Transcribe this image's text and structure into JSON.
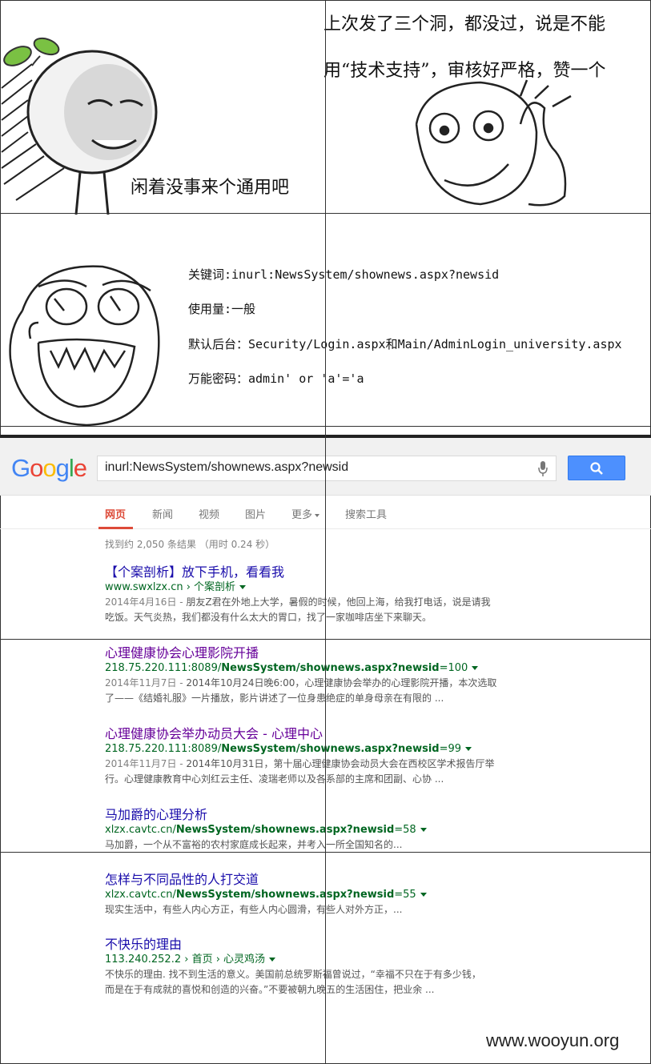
{
  "comic": {
    "panel1_caption": "闲着没事来个通用吧",
    "panel2_line1": "上次发了三个洞，都没过，说是不能",
    "panel2_line2": "用“技术支持”，审核好严格，赞一个",
    "info": [
      "关键词:inurl:NewsSystem/shownews.aspx?newsid",
      "使用量:一般",
      "默认后台：Security/Login.aspx和Main/AdminLogin_university.aspx",
      "万能密码：admin' or 'a'='a"
    ]
  },
  "google": {
    "logo": "Google",
    "search_value": "inurl:NewsSystem/shownews.aspx?newsid",
    "tabs": [
      "网页",
      "新闻",
      "视频",
      "图片",
      "更多",
      "搜索工具"
    ],
    "active_tab": "网页",
    "result_stats": "找到约 2,050 条结果 （用时 0.24 秒）",
    "results": [
      {
        "title": "【个案剖析】放下手机，看看我",
        "url_plain": "www.swxlzx.cn › 个案剖析",
        "snippet_date": "2014年4月16日 - ",
        "snippet_line1": "朋友Z君在外地上大学，暑假的时候，他回上海，给我打电话，说是请我",
        "snippet_line2": "吃饭。天气炎热，我们都没有什么太大的胃口，找了一家咖啡店坐下来聊天。"
      },
      {
        "title": "心理健康协会心理影院开播",
        "url_prefix": "218.75.220.111:8089/",
        "url_bold": "NewsSystem/shownews.aspx?newsid",
        "url_suffix": "=100",
        "snippet_date": "2014年11月7日 - ",
        "snippet_line1": "2014年10月24日晚6:00，心理健康协会举办的心理影院开播，本次选取",
        "snippet_line2": "了——《结婚礼服》一片播放，影片讲述了一位身患绝症的单身母亲在有限的 ..."
      },
      {
        "title": "心理健康协会举办动员大会 - 心理中心",
        "url_prefix": "218.75.220.111:8089/",
        "url_bold": "NewsSystem/shownews.aspx?newsid",
        "url_suffix": "=99",
        "snippet_date": "2014年11月7日 - ",
        "snippet_line1": "2014年10月31日，第十届心理健康协会动员大会在西校区学术报告厅举",
        "snippet_line2": "行。心理健康教育中心刘红云主任、凌瑞老师以及各系部的主席和团副、心协 ..."
      },
      {
        "title": "马加爵的心理分析",
        "url_prefix": "xlzx.cavtc.cn/",
        "url_bold": "NewsSystem/shownews.aspx?newsid",
        "url_suffix": "=58",
        "snippet_line1": "马加爵，一个从不富裕的农村家庭成长起来，并考入一所全国知名的..."
      },
      {
        "title": "怎样与不同品性的人打交道",
        "url_prefix": "xlzx.cavtc.cn/",
        "url_bold": "NewsSystem/shownews.aspx?newsid",
        "url_suffix": "=55",
        "snippet_line1": "现实生活中，有些人内心方正，有些人内心圆滑，有些人对外方正，..."
      },
      {
        "title": "不快乐的理由",
        "url_plain": "113.240.252.2 › 首页 › 心灵鸡汤",
        "snippet_line1": "不快乐的理由. 找不到生活的意义。美国前总统罗斯福曾说过，“幸福不只在于有多少钱，",
        "snippet_line2": "而是在于有成就的喜悦和创造的兴奋。”不要被朝九晚五的生活困住，把业余 ..."
      }
    ]
  },
  "watermark": "www.wooyun.org"
}
